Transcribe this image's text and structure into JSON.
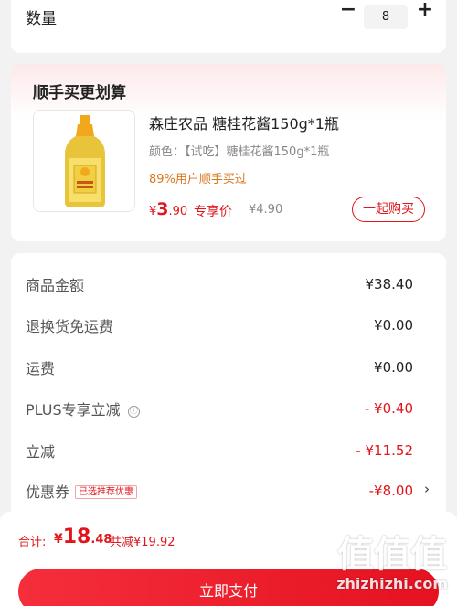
{
  "quantity": {
    "label": "数量",
    "minus": "−",
    "value": "8",
    "plus": "+"
  },
  "addon": {
    "title": "顺手买更划算",
    "product": {
      "name": "森庄农品 糖桂花酱150g*1瓶",
      "spec": "颜色：【试吃】糖桂花酱150g*1瓶",
      "bought": "89%用户顺手买过",
      "price_currency": "¥",
      "price_int": "3",
      "price_dec": ".90",
      "exclusive_label": "专享价",
      "original_price": "¥4.90",
      "buy_label": "一起购买"
    }
  },
  "summary": {
    "rows": [
      {
        "label": "商品金额",
        "value": "¥38.40"
      },
      {
        "label": "退换货免运费",
        "value": "¥0.00"
      },
      {
        "label": "运费",
        "value": "¥0.00"
      },
      {
        "label": "PLUS专享立减",
        "value": "- ¥0.40",
        "info_icon": "ⓘ"
      },
      {
        "label": "立减",
        "value": "- ¥11.52"
      },
      {
        "label": "优惠券",
        "value": "-¥8.00",
        "tag": "已选推荐优惠",
        "chevron": "›"
      }
    ]
  },
  "bottom": {
    "total_label": "合计:",
    "total_currency": "¥",
    "total_int": "18",
    "total_dec": ".48",
    "saved": "共减¥19.92",
    "pay_label": "立即支付"
  },
  "watermark": {
    "logo": "值值值",
    "url": "zhizhizhi.com"
  },
  "colors": {
    "accent_red": "#e0161b",
    "orange": "#d9751d",
    "background": "#f2f2f2"
  }
}
